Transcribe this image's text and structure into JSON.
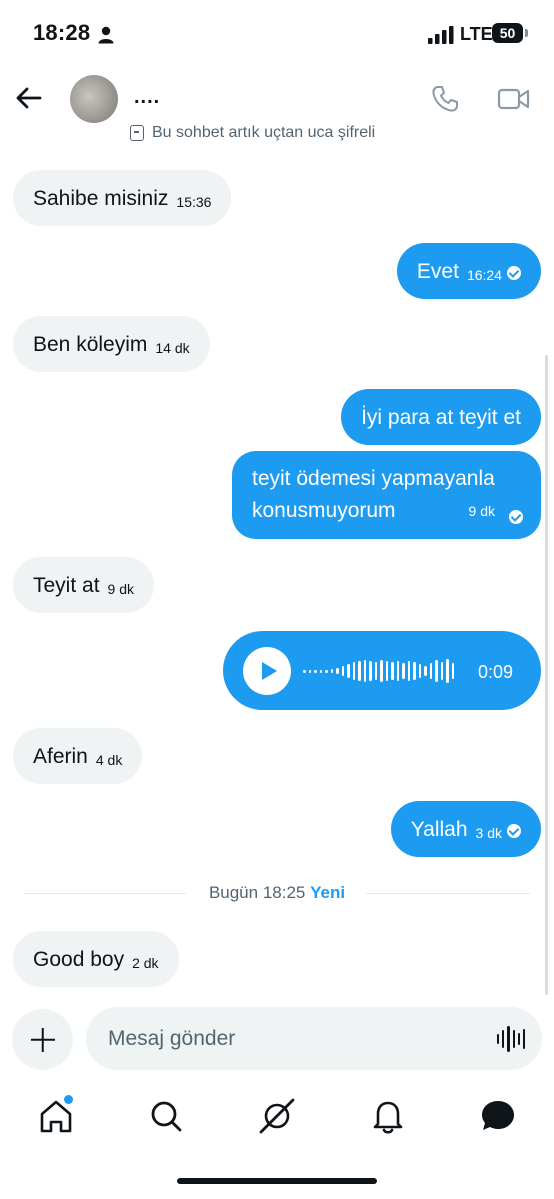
{
  "status_bar": {
    "time": "18:28",
    "network": "LTE",
    "battery": "50"
  },
  "header": {
    "contact_name": "....",
    "encryption_note": "Bu sohbet artık uçtan uca şifreli"
  },
  "messages": [
    {
      "dir": "in",
      "text": "Sahibe misiniz",
      "time": "15:36"
    },
    {
      "dir": "out",
      "text": "Evet",
      "time": "16:24",
      "read": true
    },
    {
      "dir": "in",
      "text": "Ben köleyim",
      "time": "14 dk"
    },
    {
      "dir": "out",
      "text": "İyi para at teyit et"
    },
    {
      "dir": "out",
      "text": "teyit ödemesi yapmayanla konusmuyorum",
      "time": "9 dk",
      "read": true
    },
    {
      "dir": "in",
      "text": "Teyit at",
      "time": "9 dk"
    },
    {
      "dir": "out",
      "type": "voice",
      "duration": "0:09"
    },
    {
      "dir": "in",
      "text": "Aferin",
      "time": "4 dk"
    },
    {
      "dir": "out",
      "text": "Yallah",
      "time": "3 dk",
      "read": true
    },
    {
      "dir": "in",
      "text": "Good boy",
      "time": "2 dk"
    }
  ],
  "divider": {
    "label": "Bugün 18:25",
    "badge": "Yeni"
  },
  "composer": {
    "placeholder": "Mesaj gönder"
  },
  "nav": [
    "home-icon",
    "search-icon",
    "grok-icon",
    "bell-icon",
    "messages-icon"
  ],
  "colors": {
    "accent": "#1d9bf0",
    "incoming_bg": "#eff3f4",
    "text": "#0f1419",
    "muted": "#536471"
  }
}
